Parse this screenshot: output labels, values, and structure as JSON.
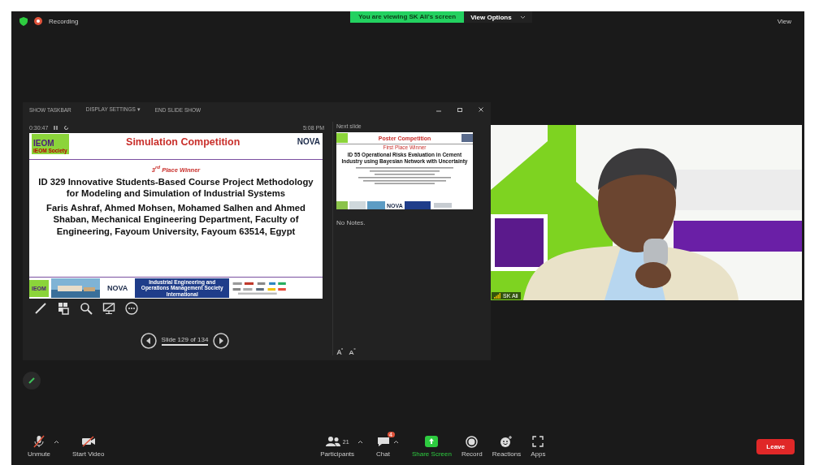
{
  "top_bar": {
    "recording": "Recording",
    "viewing": "You are viewing SK Ali's screen",
    "view_options": "View Options",
    "view": "View"
  },
  "presenter_view": {
    "toolbar": [
      "SHOW TASKBAR",
      "DISPLAY SETTINGS ▾",
      "END SLIDE SHOW"
    ],
    "timer": "0:30:47",
    "clock": "5:08 PM",
    "current_slide": {
      "logo": "IEOM",
      "logo_caption": "IEOM Society",
      "title": "Simulation Competition",
      "partner": "NOVA",
      "award": "3$^{rd}$ Place Winner",
      "heading": "ID 329     Innovative Students-Based Course Project Methodology for Modeling and Simulation of Industrial Systems",
      "authors": "Faris Ashraf, Ahmed Mohsen, Mohamed Salhen and Ahmed Shaban, Mechanical Engineering Department, Faculty of Engineering, Fayoum University, Fayoum 63514, Egypt",
      "footer_logo": "IEOM",
      "footer_partner": "NOVA",
      "footer_society": "Industrial Engineering and Operations Management Society International"
    },
    "slide_counter": "Slide 129 of 134",
    "next_slide_label": "Next slide",
    "next_slide": {
      "title": "Poster Competition",
      "award": "First Place Winner",
      "heading": "ID 55      Operational Risks Evaluation in Cement Industry using Bayesian Network with Uncertainty",
      "footer_partner": "NOVA"
    },
    "notes": "No Notes."
  },
  "video": {
    "name": "SK Ali"
  },
  "toolbar": {
    "items": [
      {
        "kind": "mic",
        "label": "Unmute"
      },
      {
        "kind": "camera",
        "label": "Start Video"
      },
      {
        "kind": "participants",
        "label": "Participants",
        "count": "21"
      },
      {
        "kind": "chat",
        "label": "Chat",
        "badge": "4"
      },
      {
        "kind": "share",
        "label": "Share Screen"
      },
      {
        "kind": "record",
        "label": "Record"
      },
      {
        "kind": "reactions",
        "label": "Reactions"
      },
      {
        "kind": "apps",
        "label": "Apps"
      }
    ],
    "leave": "Leave"
  }
}
